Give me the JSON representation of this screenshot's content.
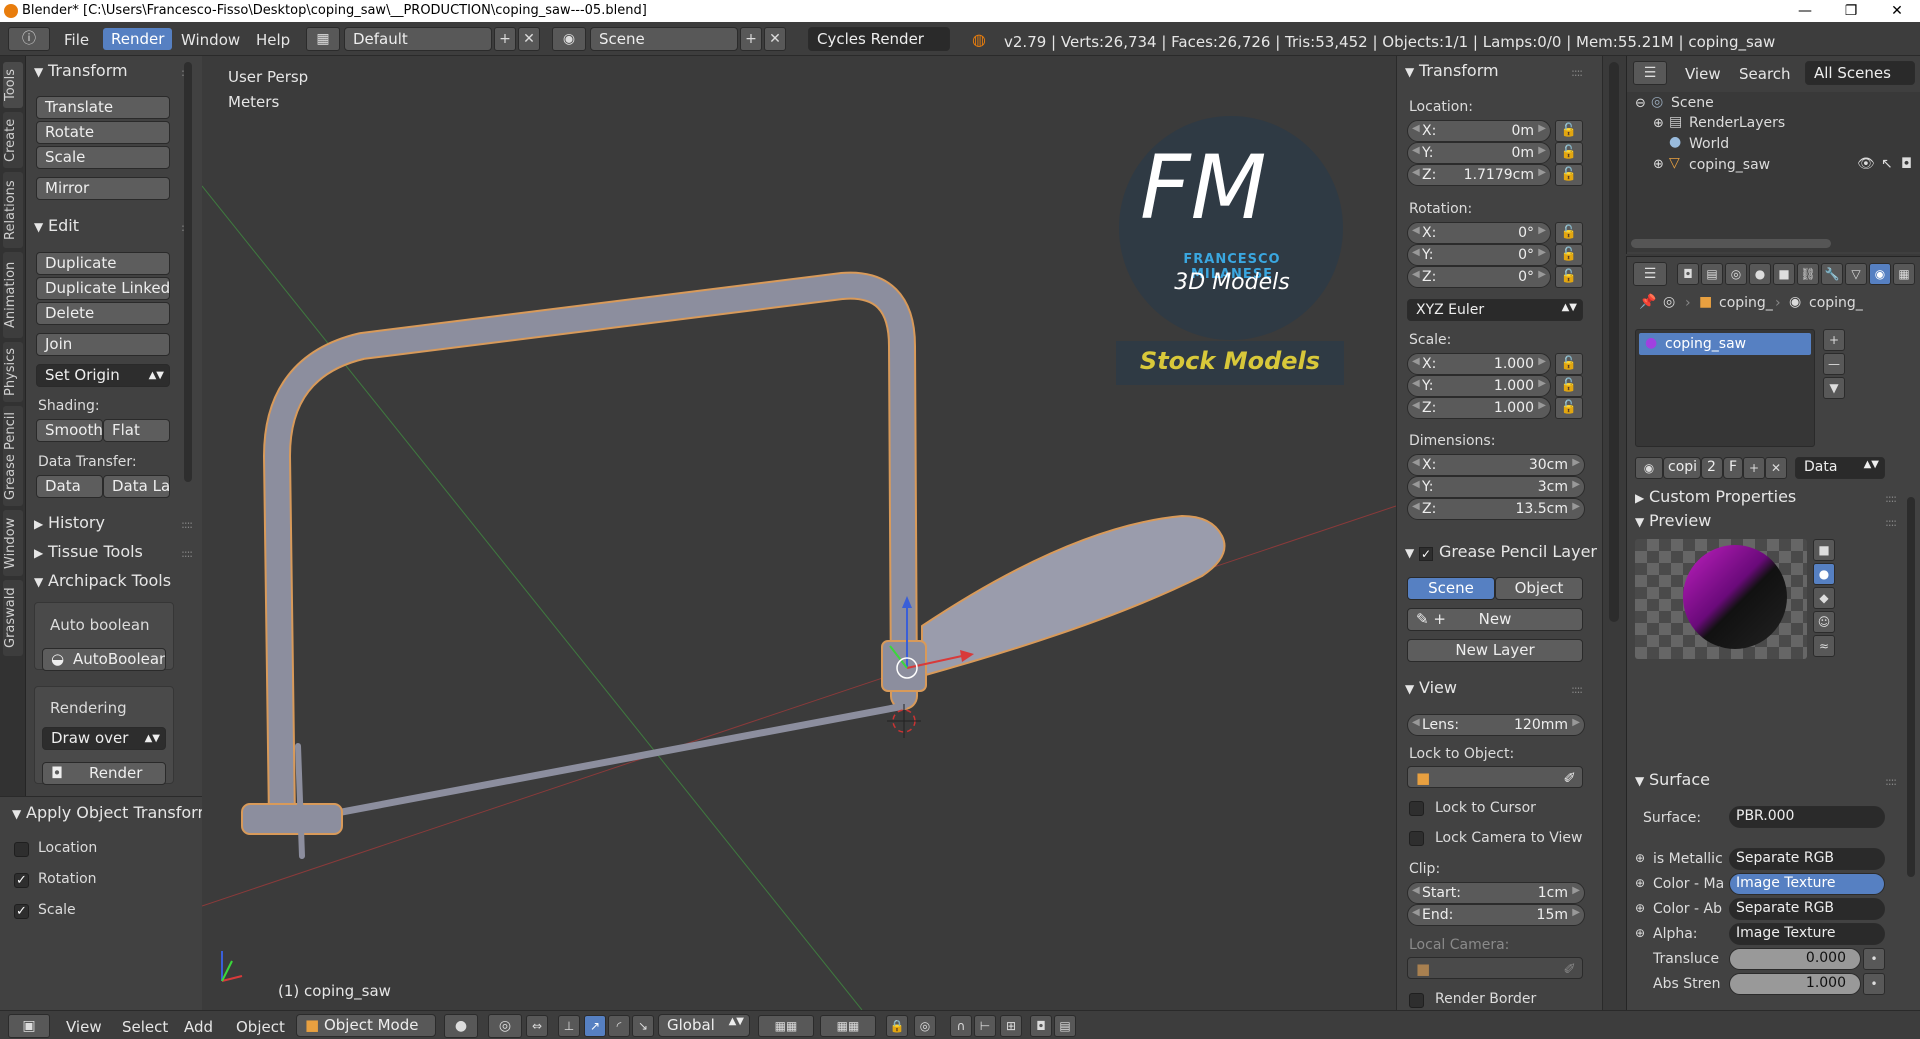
{
  "window": {
    "title": "Blender* [C:\\Users\\Francesco-Fisso\\Desktop\\coping_saw\\__PRODUCTION\\coping_saw---05.blend]",
    "minimize": "—",
    "maximize": "❐",
    "close": "✕"
  },
  "menubar": {
    "info_icon": "ⓘ",
    "menus": [
      "File",
      "Render",
      "Window",
      "Help"
    ],
    "active_menu": "Render",
    "layout": "Default",
    "scene": "Scene",
    "engine": "Cycles Render",
    "stats": "v2.79 | Verts:26,734 | Faces:26,726 | Tris:53,452 | Objects:1/1 | Lamps:0/0 | Mem:55.21M | coping_saw"
  },
  "tabs": [
    "Tools",
    "Create",
    "Relations",
    "Animation",
    "Physics",
    "Grease Pencil",
    "Window",
    "Graswald"
  ],
  "toolshelf": {
    "transform_header": "Transform",
    "translate": "Translate",
    "rotate": "Rotate",
    "scale": "Scale",
    "mirror": "Mirror",
    "edit_header": "Edit",
    "duplicate": "Duplicate",
    "duplicate_linked": "Duplicate Linked",
    "delete": "Delete",
    "join": "Join",
    "set_origin": "Set Origin",
    "shading_label": "Shading:",
    "smooth": "Smooth",
    "flat": "Flat",
    "data_transfer_label": "Data Transfer:",
    "data": "Data",
    "data_la": "Data La",
    "history_header": "History",
    "tissue_header": "Tissue Tools",
    "archipack_header": "Archipack Tools",
    "auto_boolean_label": "Auto boolean",
    "auto_boolean_btn": "AutoBoolean",
    "rendering_label": "Rendering",
    "draw_over": "Draw over",
    "render_btn": "Render"
  },
  "operator_panel": {
    "header": "Apply Object Transform",
    "options": [
      {
        "label": "Location",
        "checked": false
      },
      {
        "label": "Rotation",
        "checked": true
      },
      {
        "label": "Scale",
        "checked": true
      }
    ]
  },
  "viewport": {
    "view_name": "User Persp",
    "units": "Meters",
    "object_label": "(1) coping_saw",
    "watermark": {
      "initials": "FM",
      "name": "FRANCESCO MILANESE",
      "tagline": "3D Models",
      "stock": "Stock Models"
    }
  },
  "npanel": {
    "transform_header": "Transform",
    "location_label": "Location:",
    "location": [
      {
        "axis": "X:",
        "value": "0m"
      },
      {
        "axis": "Y:",
        "value": "0m"
      },
      {
        "axis": "Z:",
        "value": "1.7179cm"
      }
    ],
    "rotation_label": "Rotation:",
    "rotation": [
      {
        "axis": "X:",
        "value": "0°"
      },
      {
        "axis": "Y:",
        "value": "0°"
      },
      {
        "axis": "Z:",
        "value": "0°"
      }
    ],
    "rotation_mode": "XYZ Euler",
    "scale_label": "Scale:",
    "scale": [
      {
        "axis": "X:",
        "value": "1.000"
      },
      {
        "axis": "Y:",
        "value": "1.000"
      },
      {
        "axis": "Z:",
        "value": "1.000"
      }
    ],
    "dimensions_label": "Dimensions:",
    "dimensions": [
      {
        "axis": "X:",
        "value": "30cm"
      },
      {
        "axis": "Y:",
        "value": "3cm"
      },
      {
        "axis": "Z:",
        "value": "13.5cm"
      }
    ],
    "gp_header": "Grease Pencil Layer",
    "gp_scene": "Scene",
    "gp_object": "Object",
    "gp_new": "New",
    "gp_new_layer": "New Layer",
    "view_header": "View",
    "lens_label": "Lens:",
    "lens_value": "120mm",
    "lock_object_label": "Lock to Object:",
    "lock_cursor": "Lock to Cursor",
    "lock_camera": "Lock Camera to View",
    "clip_label": "Clip:",
    "clip_start_label": "Start:",
    "clip_start": "1cm",
    "clip_end_label": "End:",
    "clip_end": "15m",
    "local_camera_label": "Local Camera:",
    "render_border": "Render Border"
  },
  "outliner": {
    "view": "View",
    "search": "Search",
    "filter": "All Scenes",
    "items": [
      {
        "label": "Scene",
        "icon": "scene-icon"
      },
      {
        "label": "RenderLayers",
        "icon": "renderlayers-icon"
      },
      {
        "label": "World",
        "icon": "world-icon"
      },
      {
        "label": "coping_saw",
        "icon": "mesh-object-icon"
      }
    ]
  },
  "properties": {
    "breadcrumb_obj": "coping_",
    "breadcrumb_mat": "coping_",
    "material_slot": "coping_saw",
    "mat_name": "copi",
    "mat_users": "2",
    "fake_user": "F",
    "link": "Data",
    "custom_props": "Custom Properties",
    "preview": "Preview",
    "surface_header": "Surface",
    "surface_label": "Surface:",
    "surface_value": "PBR.000",
    "inputs": [
      {
        "label": "is Metallic",
        "value": "Separate RGB",
        "active": false
      },
      {
        "label": "Color - Ma",
        "value": "Image Texture",
        "active": true
      },
      {
        "label": "Color - Ab",
        "value": "Separate RGB",
        "active": false
      },
      {
        "label": "Alpha:",
        "value": "Image Texture",
        "active": false
      }
    ],
    "transluce_label": "Transluce",
    "transluce_value": "0.000",
    "abs_stren_label": "Abs Stren",
    "abs_stren_value": "1.000"
  },
  "bottombar": {
    "menus": [
      "View",
      "Select",
      "Add",
      "Object"
    ],
    "mode": "Object Mode",
    "orientation": "Global"
  }
}
